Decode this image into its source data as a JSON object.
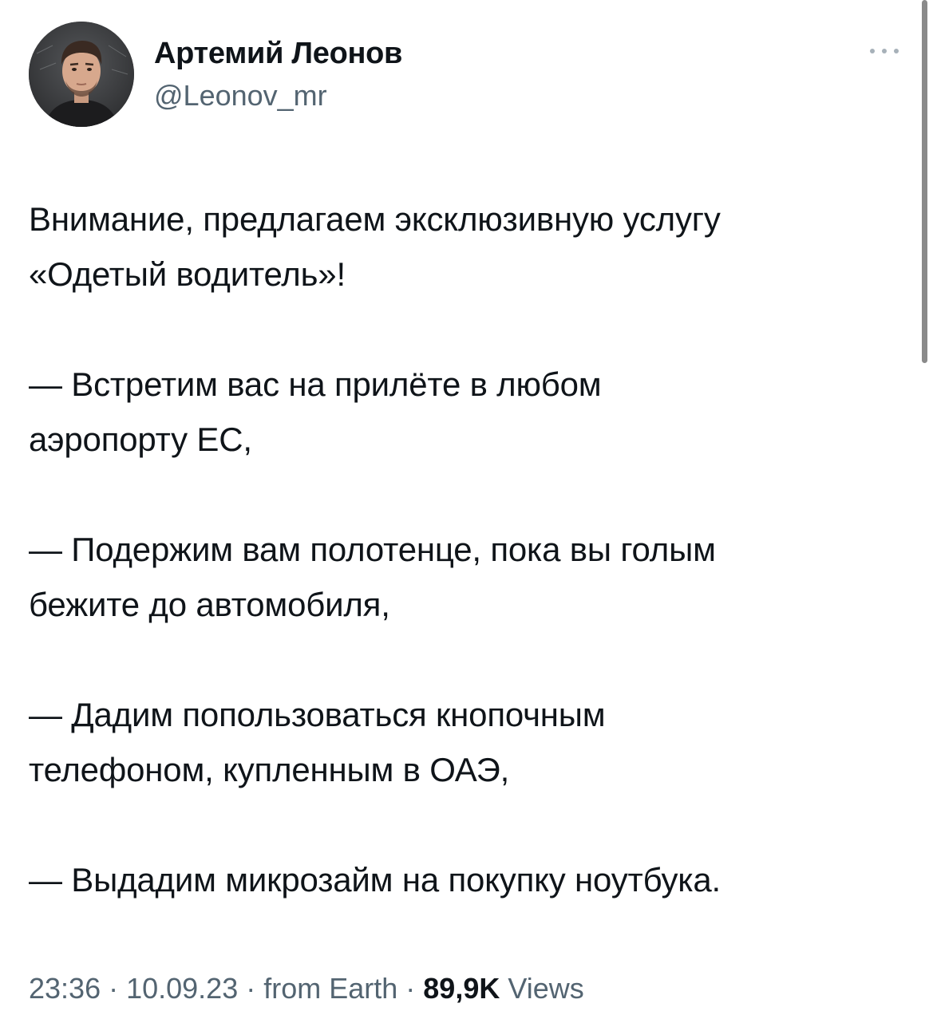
{
  "author": {
    "name": "Артемий Леонов",
    "handle": "@Leonov_mr"
  },
  "more_icon": "more-horizontal-icon",
  "tweet": {
    "paragraphs": [
      [
        "Внимание, предлагаем эксклюзивную услугу",
        "«Одетый водитель»!"
      ],
      [
        "— Встретим вас на прилёте в любом",
        "аэропорту ЕС,"
      ],
      [
        "— Подержим вам полотенце, пока вы голым",
        "бежите до автомобиля,"
      ],
      [
        "— Дадим попользоваться кнопочным",
        "телефоном, купленным в ОАЭ,"
      ],
      [
        "— Выдадим микрозайм на покупку ноутбука."
      ]
    ]
  },
  "meta": {
    "time": "23:36",
    "separator": " · ",
    "date": "10.09.23",
    "source": "from Earth",
    "views_count": "89,9K",
    "views_label": " Views"
  },
  "colors": {
    "text": "#0f1419",
    "secondary": "#536471",
    "background": "#ffffff"
  }
}
